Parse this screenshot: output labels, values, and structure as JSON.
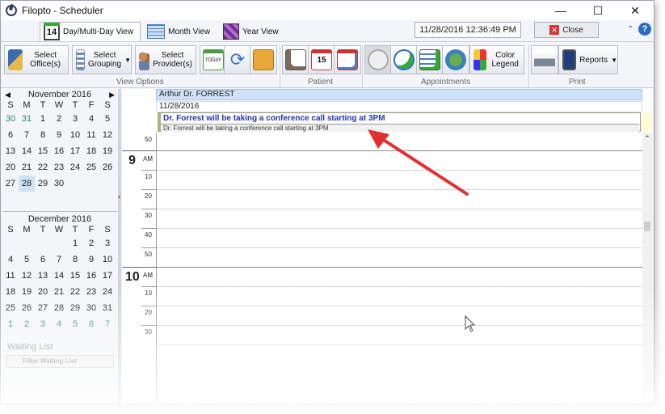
{
  "window": {
    "title": "Filopto - Scheduler",
    "min": "—",
    "max": "☐",
    "close": "✕"
  },
  "views": [
    {
      "label": "Day/Multi-Day View",
      "icon_text": "14"
    },
    {
      "label": "Month View"
    },
    {
      "label": "Year View"
    }
  ],
  "header": {
    "datetime": "11/28/2016 12:36:49 PM",
    "close_label": "Close",
    "help": "?"
  },
  "ribbon": {
    "select_offices": "Select Office(s)",
    "select_grouping": "Select Grouping",
    "select_providers": "Select Provider(s)",
    "today": "TODAY",
    "cal15": "15",
    "color_legend": "Color Legend",
    "reports": "Reports",
    "groups": {
      "view_options": "View Options",
      "patient": "Patient",
      "appointments": "Appointments",
      "print": "Print"
    }
  },
  "calendar": {
    "dow": [
      "S",
      "M",
      "T",
      "W",
      "T",
      "F",
      "S"
    ],
    "november": {
      "title": "November 2016",
      "weeks": [
        [
          [
            "30",
            1
          ],
          [
            "31",
            1
          ],
          [
            "1",
            0
          ],
          [
            "2",
            0
          ],
          [
            "3",
            0
          ],
          [
            "4",
            0
          ],
          [
            "5",
            0
          ]
        ],
        [
          [
            "6",
            0
          ],
          [
            "7",
            0
          ],
          [
            "8",
            0
          ],
          [
            "9",
            0
          ],
          [
            "10",
            0
          ],
          [
            "11",
            0
          ],
          [
            "12",
            0
          ]
        ],
        [
          [
            "13",
            0
          ],
          [
            "14",
            0
          ],
          [
            "15",
            0
          ],
          [
            "16",
            0
          ],
          [
            "17",
            0
          ],
          [
            "18",
            0
          ],
          [
            "19",
            0
          ]
        ],
        [
          [
            "20",
            0
          ],
          [
            "21",
            0
          ],
          [
            "22",
            0
          ],
          [
            "23",
            0
          ],
          [
            "24",
            0
          ],
          [
            "25",
            0
          ],
          [
            "26",
            0
          ]
        ],
        [
          [
            "27",
            0
          ],
          [
            "28",
            2
          ],
          [
            "29",
            0
          ],
          [
            "30",
            0
          ],
          [
            "",
            0
          ],
          [
            "",
            0
          ],
          [
            "",
            0
          ]
        ]
      ]
    },
    "december": {
      "title": "December 2016",
      "weeks": [
        [
          [
            "",
            0
          ],
          [
            "",
            0
          ],
          [
            "",
            0
          ],
          [
            "",
            0
          ],
          [
            "1",
            0
          ],
          [
            "2",
            0
          ],
          [
            "3",
            0
          ]
        ],
        [
          [
            "4",
            0
          ],
          [
            "5",
            0
          ],
          [
            "6",
            0
          ],
          [
            "7",
            0
          ],
          [
            "8",
            0
          ],
          [
            "9",
            0
          ],
          [
            "10",
            0
          ]
        ],
        [
          [
            "11",
            0
          ],
          [
            "12",
            0
          ],
          [
            "13",
            0
          ],
          [
            "14",
            0
          ],
          [
            "15",
            0
          ],
          [
            "16",
            0
          ],
          [
            "17",
            0
          ]
        ],
        [
          [
            "18",
            0
          ],
          [
            "19",
            0
          ],
          [
            "20",
            0
          ],
          [
            "21",
            0
          ],
          [
            "22",
            0
          ],
          [
            "23",
            0
          ],
          [
            "24",
            0
          ]
        ],
        [
          [
            "25",
            0
          ],
          [
            "26",
            0
          ],
          [
            "27",
            0
          ],
          [
            "28",
            0
          ],
          [
            "29",
            0
          ],
          [
            "30",
            0
          ],
          [
            "31",
            0
          ]
        ],
        [
          [
            "1",
            1
          ],
          [
            "2",
            1
          ],
          [
            "3",
            1
          ],
          [
            "4",
            1
          ],
          [
            "5",
            1
          ],
          [
            "6",
            1
          ],
          [
            "7",
            1
          ]
        ]
      ]
    }
  },
  "waiting_list": {
    "title": "Waiting List",
    "filter_label": "Filter Waiting List"
  },
  "schedule": {
    "provider": "Arthur Dr. FORREST",
    "date": "11/28/2016",
    "appointment_title": "Dr. Forrest will be taking a conference call starting at 3PM",
    "appointment_note": "Dr. Forrest will be taking a conference call starting at 3PM",
    "hours": [
      {
        "hour": "9",
        "ampm": "AM"
      },
      {
        "hour": "10",
        "ampm": "AM"
      }
    ],
    "minute_labels": [
      "50",
      "10",
      "20",
      "30",
      "40",
      "50",
      "10",
      "20",
      "30"
    ]
  },
  "colors": {
    "accent": "#2b6cc0",
    "appointment_text": "#2233bb",
    "provider_header": "#cfe2f8",
    "arrow": "#e03030"
  }
}
